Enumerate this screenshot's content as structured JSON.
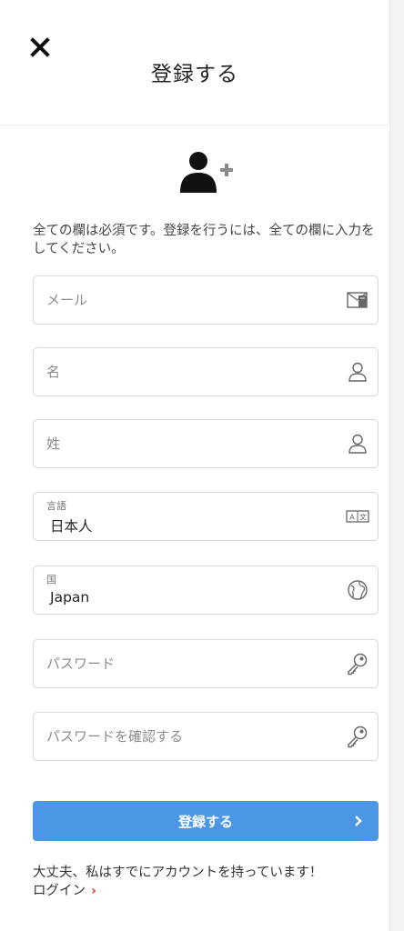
{
  "header": {
    "title": "登録する"
  },
  "intro": "全ての欄は必須です。登録を行うには、全ての欄に入力をしてください。",
  "fields": {
    "email": {
      "placeholder": "メール"
    },
    "first_name": {
      "placeholder": "名"
    },
    "last_name": {
      "placeholder": "姓"
    },
    "language": {
      "label": "言語",
      "value": "日本人"
    },
    "country": {
      "label": "国",
      "value": "Japan"
    },
    "password": {
      "placeholder": "パスワード"
    },
    "password_confirm": {
      "placeholder": "パスワードを確認する"
    }
  },
  "submit": {
    "label": "登録する"
  },
  "footer": {
    "text": "大丈夫、私はすでにアカウントを持っています！",
    "login_label": "ログイン",
    "login_arrow": "›"
  },
  "colors": {
    "accent": "#4b97e6",
    "link_arrow": "#d93a3a"
  }
}
